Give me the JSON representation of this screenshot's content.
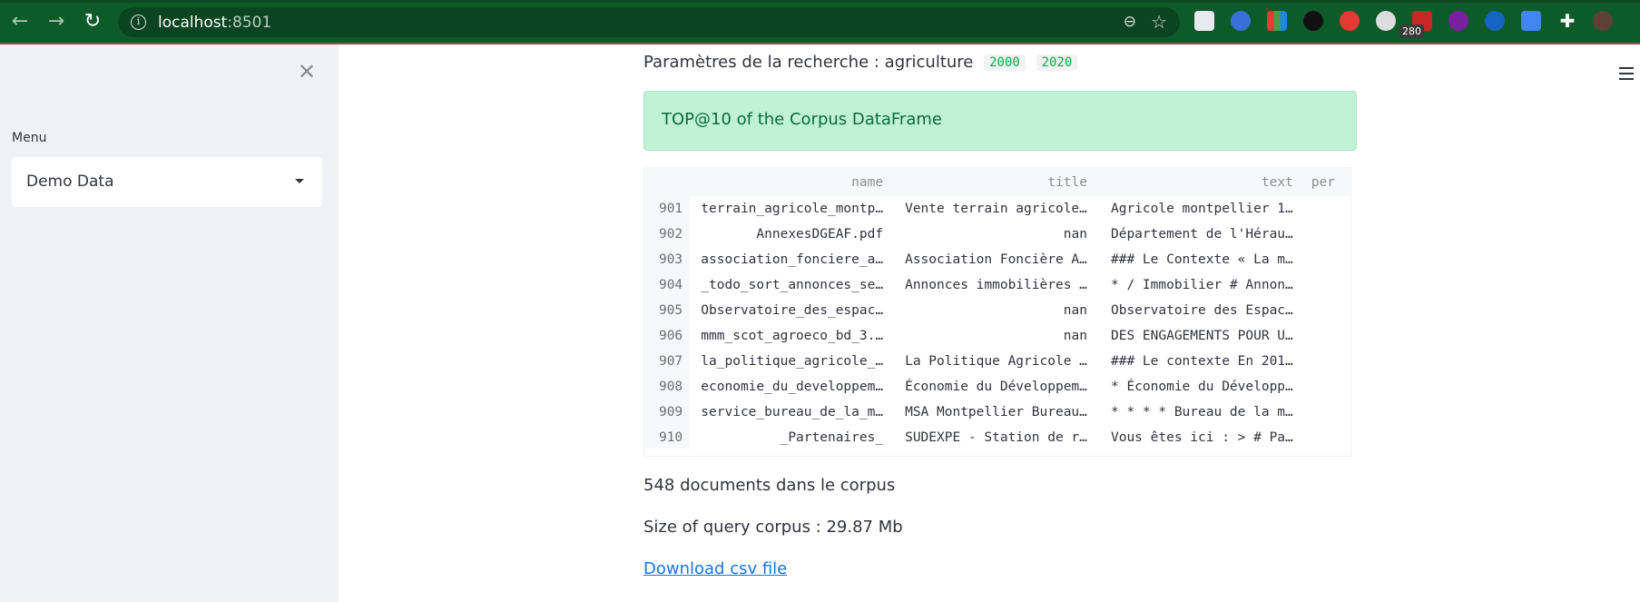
{
  "browser": {
    "url_host": "localhost",
    "url_port": ":8501",
    "extension_badge": "280"
  },
  "sidebar": {
    "menu_label": "Menu",
    "select_value": "Demo Data"
  },
  "main": {
    "params_label": "Paramètres de la recherche : agriculture",
    "params_chips": [
      "2000",
      "2020"
    ],
    "success_text": "TOP@10 of the Corpus DataFrame",
    "table": {
      "columns": [
        "name",
        "title",
        "text",
        "per"
      ],
      "rows": [
        {
          "index": "901",
          "name": "terrain_agricole_montp…",
          "title": "Vente terrain agricole…",
          "text": "Agricole montpellier 1…",
          "title_right": false
        },
        {
          "index": "902",
          "name": "AnnexesDGEAF.pdf",
          "title": "nan",
          "text": "Département de l'Hérau…",
          "title_right": true
        },
        {
          "index": "903",
          "name": "association_fonciere_a…",
          "title": "Association Foncière A…",
          "text": "### Le Contexte « La m…",
          "title_right": false
        },
        {
          "index": "904",
          "name": "_todo_sort_annonces_se…",
          "title": "Annonces immobilières …",
          "text": "* / Immobilier # Annon…",
          "title_right": false
        },
        {
          "index": "905",
          "name": "Observatoire_des_espac…",
          "title": "nan",
          "text": "Observatoire des Espac…",
          "title_right": true
        },
        {
          "index": "906",
          "name": "mmm_scot_agroeco_bd_3.…",
          "title": "nan",
          "text": "DES ENGAGEMENTS POUR U…",
          "title_right": true
        },
        {
          "index": "907",
          "name": "la_politique_agricole_…",
          "title": "La Politique Agricole …",
          "text": "### Le contexte En 201…",
          "title_right": false
        },
        {
          "index": "908",
          "name": "economie_du_developpem…",
          "title": "Économie du Développem…",
          "text": "* Économie du Développ…",
          "title_right": false
        },
        {
          "index": "909",
          "name": "service_bureau_de_la_m…",
          "title": "MSA Montpellier Bureau…",
          "text": "* * * * Bureau de la m…",
          "title_right": false
        },
        {
          "index": "910",
          "name": "_Partenaires_",
          "title": "SUDEXPE - Station de r…",
          "text": "Vous êtes ici : > # Pa…",
          "title_right": false
        }
      ]
    },
    "docs_count": "548 documents dans le corpus",
    "size_text": "Size of query corpus : 29.87 Mb",
    "download_link": "Download csv file"
  }
}
